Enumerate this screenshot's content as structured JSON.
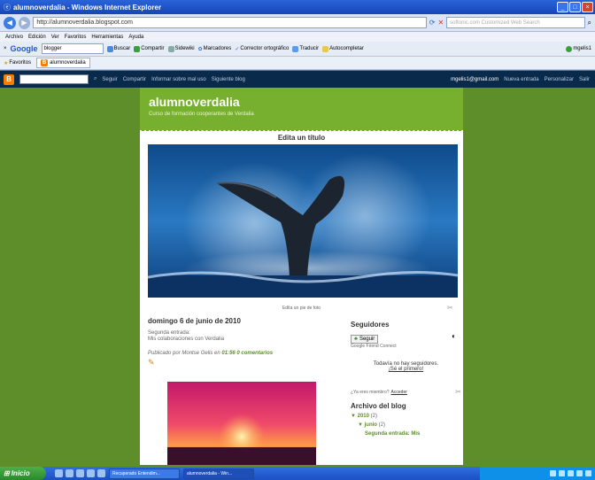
{
  "window": {
    "title": "alumnoverdalia - Windows Internet Explorer"
  },
  "address": {
    "url": "http://alumnoverdalia.blogspot.com",
    "search_placeholder": "softonic.com Customized Web Search"
  },
  "menu": [
    "Archivo",
    "Edición",
    "Ver",
    "Favoritos",
    "Herramientas",
    "Ayuda"
  ],
  "googlebar": {
    "logo": "Google",
    "query": "blogger",
    "items": [
      "Buscar",
      "Compartir",
      "Sidewiki",
      "Marcadores",
      "Corrector ortográfico",
      "Traducir",
      "Autocompletar"
    ],
    "account": "mgelis1"
  },
  "favbar": {
    "favorites": "Favoritos",
    "tab": "alumnoverdalia"
  },
  "blognav": {
    "links": [
      "Seguir",
      "Compartir",
      "Informar sobre mal uso",
      "Siguiente blog"
    ],
    "email": "mgelis1@gmail.com",
    "right_links": [
      "Nueva entrada",
      "Personalizar",
      "Salir"
    ]
  },
  "blog": {
    "title": "alumnoverdalia",
    "description": "Curso de formación cooperantes de Verdalia",
    "edit_title": "Edita un título",
    "caption": "Edita un pie de foto"
  },
  "post": {
    "date": "domingo 6 de junio de 2010",
    "title": "Segunda entrada:",
    "body": "Mis colaboraciones con Verdalia",
    "meta_prefix": "Publicado por Montse Gelis en",
    "time": "01:56",
    "comments": "0 comentarios"
  },
  "sidebar": {
    "followers_title": "Seguidores",
    "follow_label": "Seguir",
    "gfc": "Google Friend Connect",
    "no_followers": "Todavía no hay seguidores.",
    "be_first": "¡Sé el primero!",
    "member_prefix": "¿Ya eres miembro?",
    "member_link": "Acceder",
    "archive_title": "Archivo del blog",
    "year": "2010",
    "year_count": "(2)",
    "month": "junio",
    "month_count": "(2)",
    "entry": "Segunda entrada: Mis"
  },
  "taskbar": {
    "start": "Inicio",
    "buttons": [
      "Recuperado Entendim...",
      "alumnoverdalia - Win..."
    ]
  }
}
